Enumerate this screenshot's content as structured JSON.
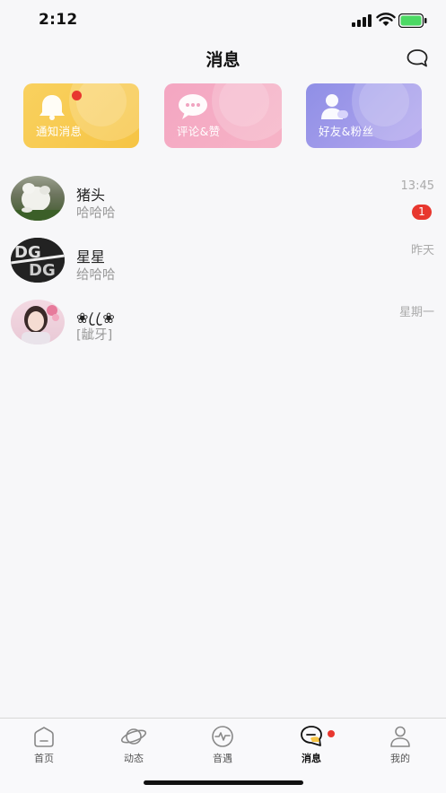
{
  "status_bar": {
    "time": "2:12",
    "battery_color": "#4cd964"
  },
  "header": {
    "title": "消息",
    "chat_icon": "chat-bubble-icon"
  },
  "cards": [
    {
      "label": "通知消息",
      "icon": "bell-icon",
      "has_dot": true
    },
    {
      "label": "评论&赞",
      "icon": "comment-bubble-icon"
    },
    {
      "label": "好友&粉丝",
      "icon": "person-icon"
    }
  ],
  "conversations": [
    {
      "name": "猪头",
      "preview": "哈哈哈",
      "time": "13:45",
      "unread": "1"
    },
    {
      "name": "星星",
      "preview": "给哈哈",
      "time": "昨天"
    },
    {
      "name": "❀ ꦿ ꦿ❀",
      "preview": "[龇牙]",
      "time": "星期一"
    }
  ],
  "tabs": [
    {
      "label": "首页",
      "icon": "home-icon"
    },
    {
      "label": "动态",
      "icon": "planet-icon"
    },
    {
      "label": "音遇",
      "icon": "pulse-icon"
    },
    {
      "label": "消息",
      "icon": "message-icon",
      "active": true,
      "has_dot": true
    },
    {
      "label": "我的",
      "icon": "profile-icon"
    }
  ],
  "colors": {
    "accent_yellow": "#f6c444",
    "badge_red": "#e8372f",
    "pink": "#f4a6c2",
    "purple": "#8f8fe6"
  }
}
